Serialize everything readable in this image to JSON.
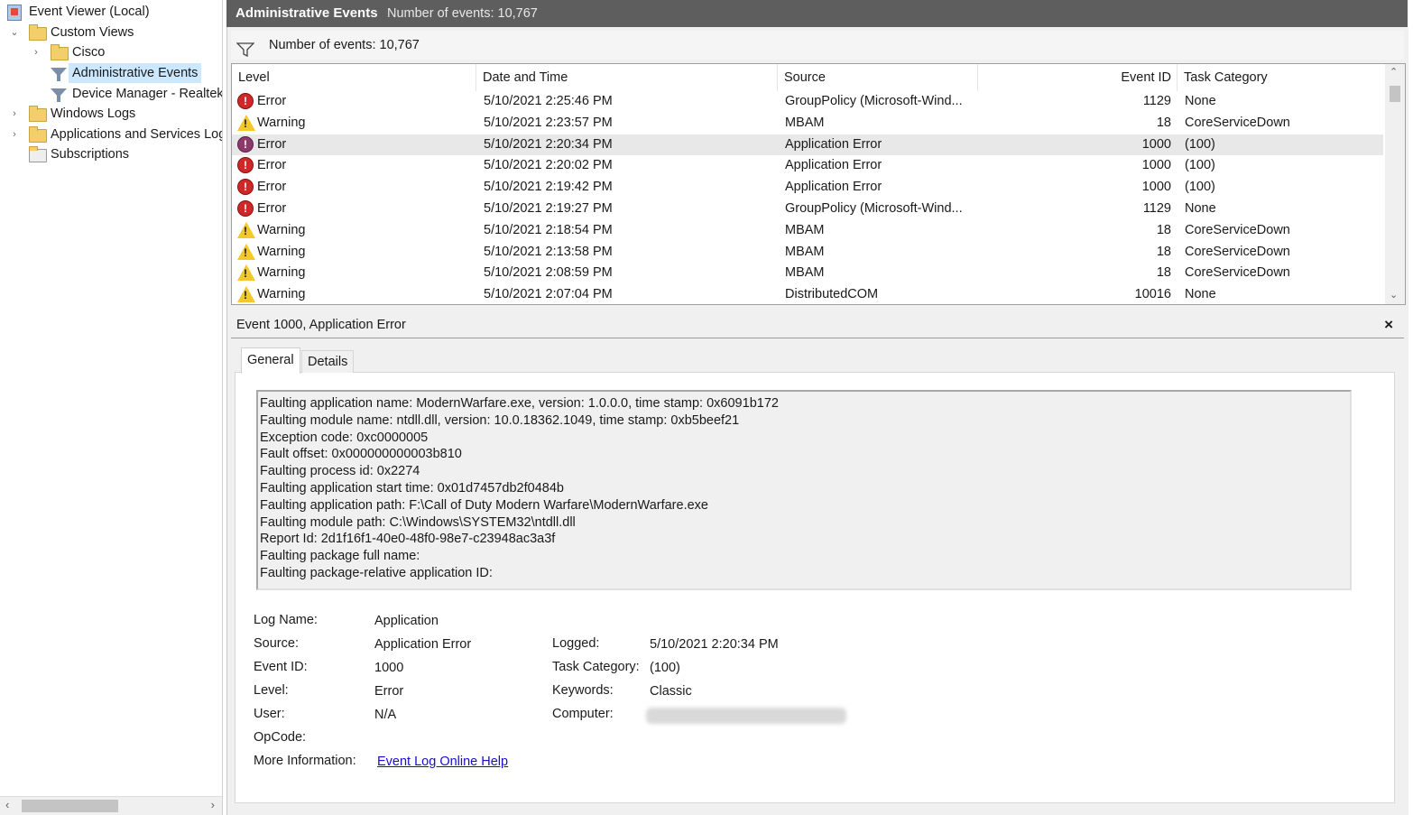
{
  "tree": {
    "root": "Event Viewer (Local)",
    "custom_views": "Custom Views",
    "cisco": "Cisco",
    "administrative_events": "Administrative Events",
    "device_manager": "Device Manager - Realtek",
    "windows_logs": "Windows Logs",
    "apps_services": "Applications and Services Logs",
    "subscriptions": "Subscriptions"
  },
  "header": {
    "title": "Administrative Events",
    "count": "Number of events: 10,767"
  },
  "filter_bar": {
    "text": "Number of events: 10,767"
  },
  "grid": {
    "columns": [
      "Level",
      "Date and Time",
      "Source",
      "Event ID",
      "Task Category"
    ],
    "rows": [
      {
        "level": "Error",
        "date": "5/10/2021 2:25:46 PM",
        "source": "GroupPolicy (Microsoft-Wind...",
        "id": "1129",
        "task": "None"
      },
      {
        "level": "Warning",
        "date": "5/10/2021 2:23:57 PM",
        "source": "MBAM",
        "id": "18",
        "task": "CoreServiceDown"
      },
      {
        "level": "Error",
        "date": "5/10/2021 2:20:34 PM",
        "source": "Application Error",
        "id": "1000",
        "task": "(100)"
      },
      {
        "level": "Error",
        "date": "5/10/2021 2:20:02 PM",
        "source": "Application Error",
        "id": "1000",
        "task": "(100)"
      },
      {
        "level": "Error",
        "date": "5/10/2021 2:19:42 PM",
        "source": "Application Error",
        "id": "1000",
        "task": "(100)"
      },
      {
        "level": "Error",
        "date": "5/10/2021 2:19:27 PM",
        "source": "GroupPolicy (Microsoft-Wind...",
        "id": "1129",
        "task": "None"
      },
      {
        "level": "Warning",
        "date": "5/10/2021 2:18:54 PM",
        "source": "MBAM",
        "id": "18",
        "task": "CoreServiceDown"
      },
      {
        "level": "Warning",
        "date": "5/10/2021 2:13:58 PM",
        "source": "MBAM",
        "id": "18",
        "task": "CoreServiceDown"
      },
      {
        "level": "Warning",
        "date": "5/10/2021 2:08:59 PM",
        "source": "MBAM",
        "id": "18",
        "task": "CoreServiceDown"
      },
      {
        "level": "Warning",
        "date": "5/10/2021 2:07:04 PM",
        "source": "DistributedCOM",
        "id": "10016",
        "task": "None"
      }
    ]
  },
  "detail": {
    "title": "Event 1000, Application Error",
    "close": "×",
    "tabs": [
      "General",
      "Details"
    ],
    "description": [
      "Faulting application name: ModernWarfare.exe, version: 1.0.0.0, time stamp: 0x6091b172",
      "Faulting module name: ntdll.dll, version: 10.0.18362.1049, time stamp: 0xb5beef21",
      "Exception code: 0xc0000005",
      "Fault offset: 0x000000000003b810",
      "Faulting process id: 0x2274",
      "Faulting application start time: 0x01d7457db2f0484b",
      "Faulting application path: F:\\Call of Duty Modern Warfare\\ModernWarfare.exe",
      "Faulting module path: C:\\Windows\\SYSTEM32\\ntdll.dll",
      "Report Id: 2d1f16f1-40e0-48f0-98e7-c23948ac3a3f",
      "Faulting package full name:",
      "Faulting package-relative application ID:"
    ],
    "fields": {
      "log_name_label": "Log Name:",
      "log_name": "Application",
      "source_label": "Source:",
      "source": "Application Error",
      "logged_label": "Logged:",
      "logged": "5/10/2021 2:20:34 PM",
      "event_id_label": "Event ID:",
      "event_id": "1000",
      "task_category_label": "Task Category:",
      "task_category": "(100)",
      "level_label": "Level:",
      "level": "Error",
      "keywords_label": "Keywords:",
      "keywords": "Classic",
      "user_label": "User:",
      "user": "N/A",
      "computer_label": "Computer:",
      "opcode_label": "OpCode:",
      "more_info_label": "More Information:",
      "more_info_link": "Event Log Online Help"
    }
  }
}
